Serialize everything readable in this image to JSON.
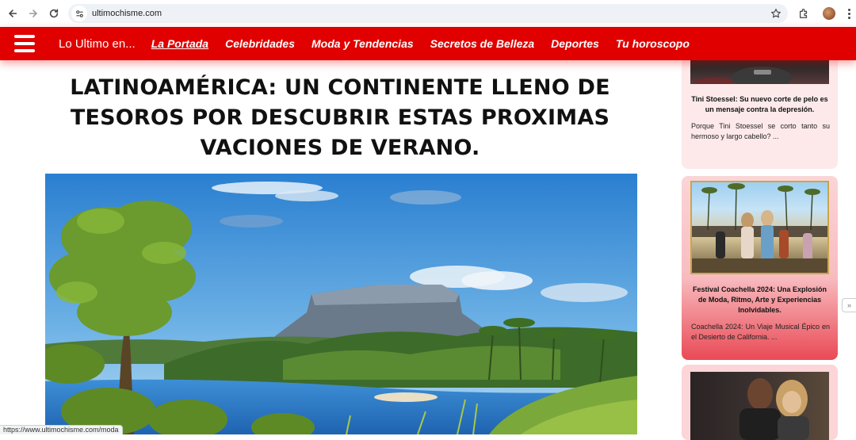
{
  "browser": {
    "url": "ultimochisme.com",
    "status_url": "https://www.ultimochisme.com/moda"
  },
  "header": {
    "brand": "Lo Ultimo en...",
    "menu": [
      {
        "label": "La Portada",
        "active": true
      },
      {
        "label": "Celebridades"
      },
      {
        "label": "Moda y Tendencias"
      },
      {
        "label": "Secretos de Belleza"
      },
      {
        "label": "Deportes"
      },
      {
        "label": "Tu horoscopo"
      }
    ],
    "color": "#e00000"
  },
  "article": {
    "title": "LATINOAMÉRICA: UN CONTINENTE LLENO DE TESOROS POR DESCUBRIR ESTAS PROXIMAS VACIONES DE VERANO."
  },
  "sidebar": {
    "cards": [
      {
        "title": "Tini Stoessel: Su nuevo corte de pelo es un mensaje contra la depresión.",
        "desc": "Porque Tini Stoessel se corto tanto su hermoso y largo cabello? ..."
      },
      {
        "title": "Festival Coachella 2024: Una Explosión de Moda, Ritmo, Arte y Experiencias Inolvidables.",
        "desc": "Coachella 2024: Un Viaje Musical Épico en el Desierto de California. ..."
      },
      {
        "title": "",
        "desc": ""
      }
    ]
  },
  "icons": {
    "back": "back-arrow-icon",
    "forward": "forward-arrow-icon",
    "reload": "reload-icon",
    "site_info": "site-info-icon",
    "bookmark": "star-icon",
    "extensions": "puzzle-icon",
    "menu": "hamburger-icon"
  }
}
